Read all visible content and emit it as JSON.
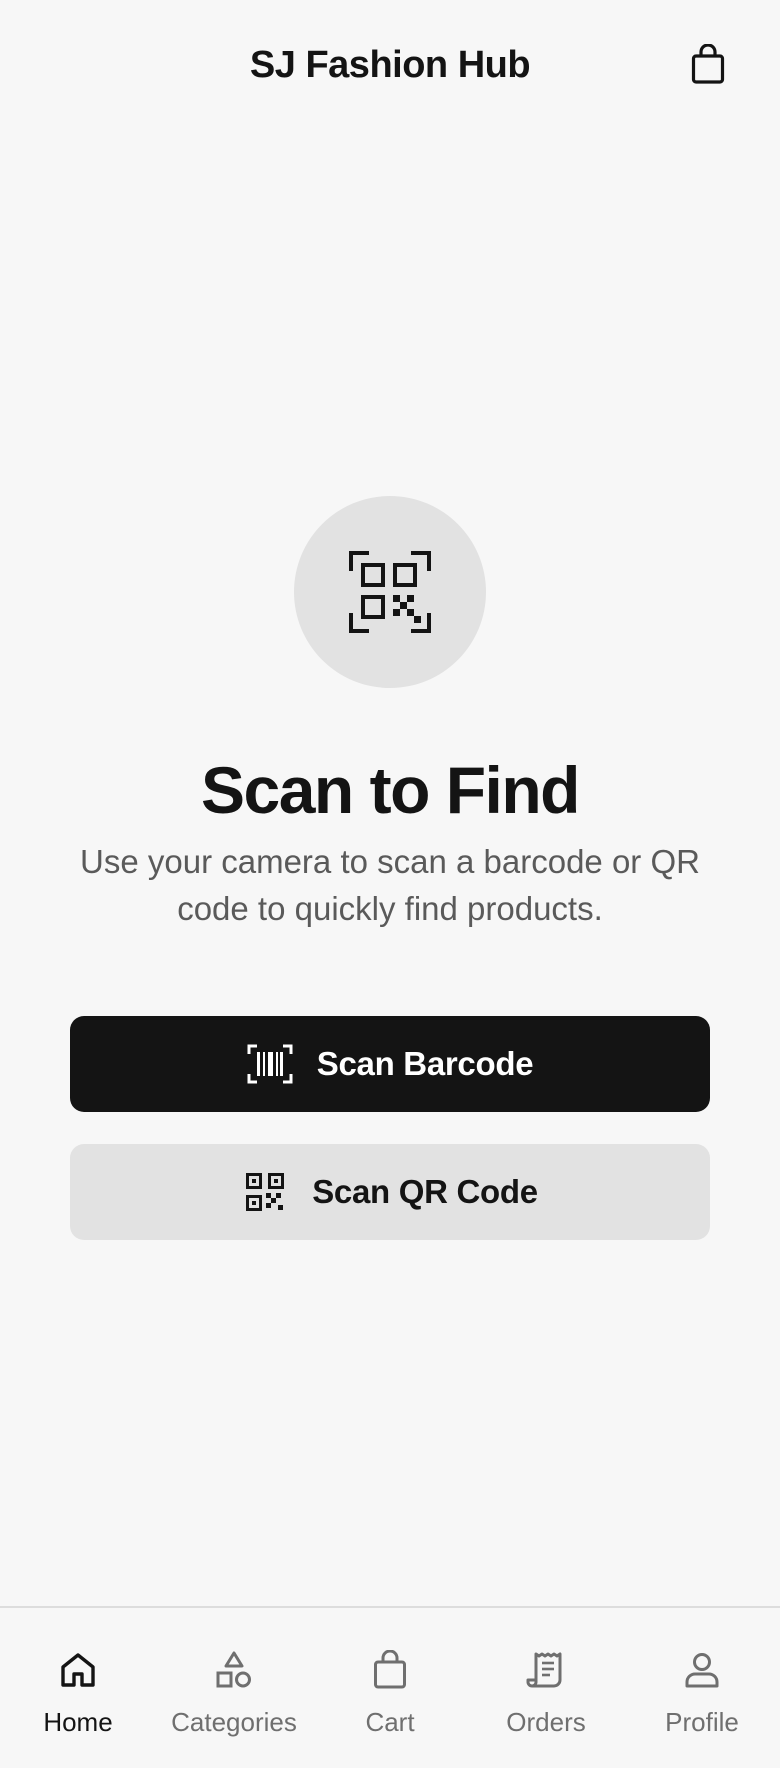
{
  "header": {
    "title": "SJ Fashion Hub",
    "cart_icon": "shopping-bag-icon"
  },
  "hero": {
    "icon": "qr-code-scan-icon",
    "title": "Scan to Find",
    "subtitle": "Use your camera to scan a barcode or QR code to quickly find products."
  },
  "actions": {
    "scan_barcode": {
      "label": "Scan Barcode",
      "icon": "barcode-scan-icon"
    },
    "scan_qr": {
      "label": "Scan QR Code",
      "icon": "qr-code-icon"
    }
  },
  "bottom_nav": {
    "active": "Home",
    "items": [
      {
        "label": "Home",
        "icon": "home-icon"
      },
      {
        "label": "Categories",
        "icon": "categories-icon"
      },
      {
        "label": "Cart",
        "icon": "cart-bag-icon"
      },
      {
        "label": "Orders",
        "icon": "receipt-icon"
      },
      {
        "label": "Profile",
        "icon": "person-icon"
      }
    ]
  },
  "colors": {
    "background": "#f7f7f7",
    "primary": "#141414",
    "secondary_surface": "#e2e2e2",
    "muted_text": "#6f6f6f"
  }
}
